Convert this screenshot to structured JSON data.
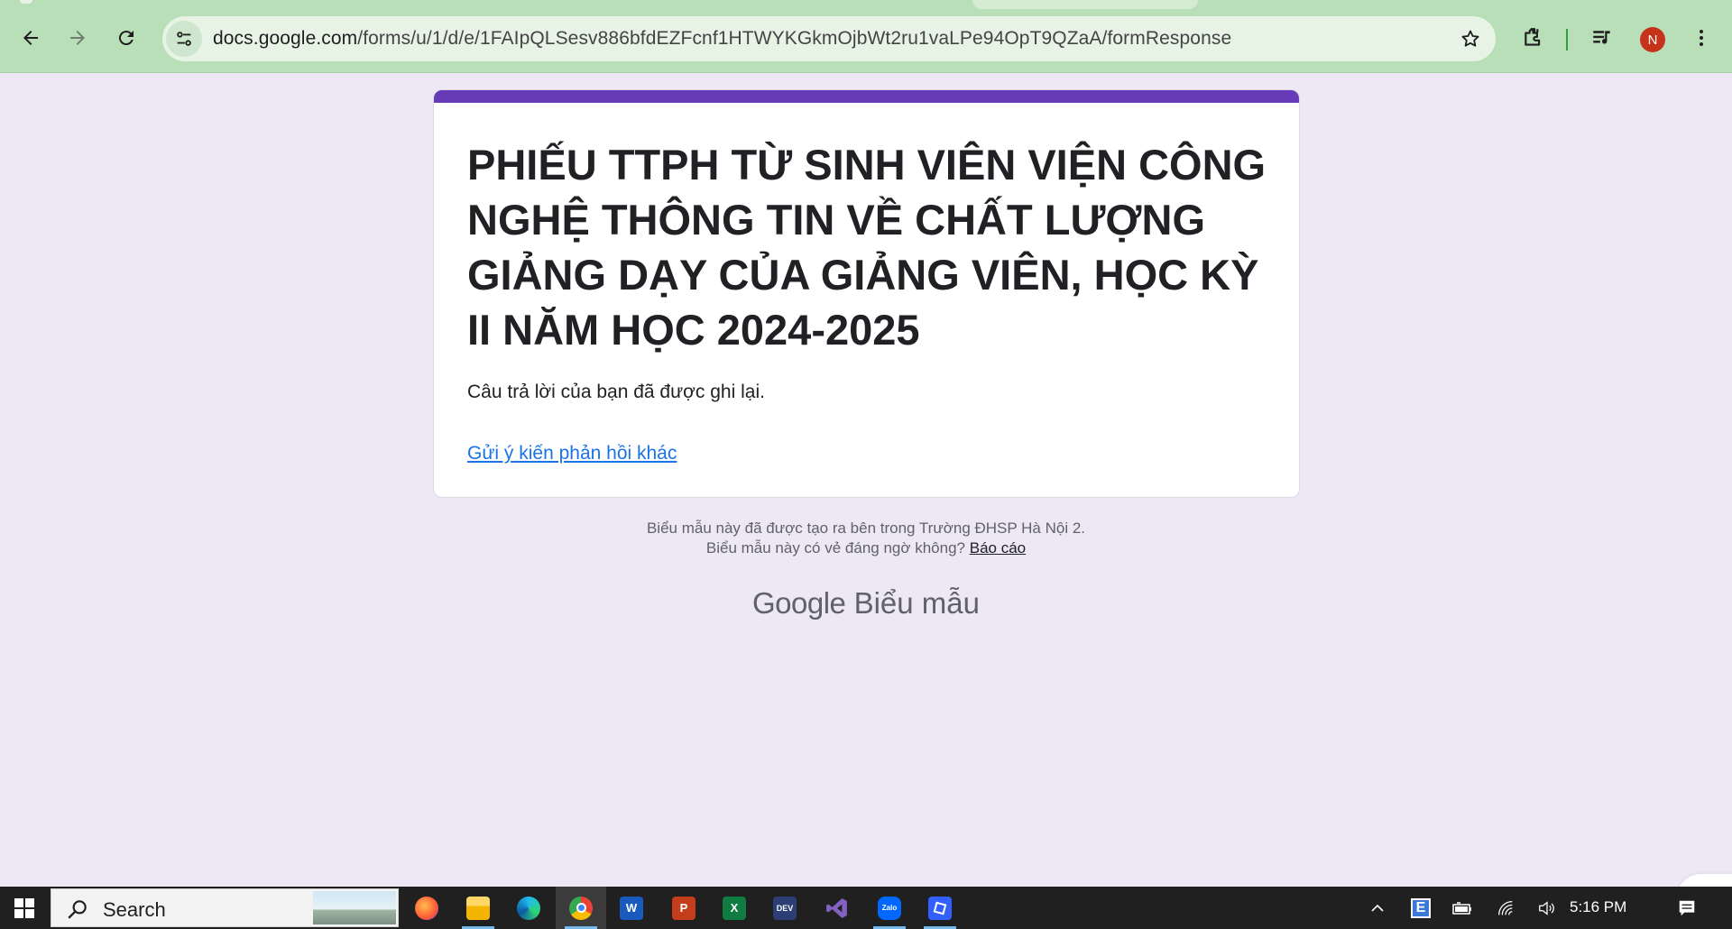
{
  "browser": {
    "url_host": "docs.google.com",
    "url_path": "/forms/u/1/d/e/1FAIpQLSesv886bfdEZFcnf1HTWYKGkmOjbWt2ru1vaLPe94OpT9QZaA/formResponse",
    "profile_initial": "N",
    "icons": [
      "back-icon",
      "forward-icon",
      "reload-icon",
      "site-info-icon",
      "bookmark-star-icon",
      "extensions-icon",
      "media-control-icon",
      "menu-kebab-icon"
    ]
  },
  "form": {
    "title": "PHIẾU TTPH TỪ SINH VIÊN VIỆN CÔNG NGHỆ THÔNG TIN VỀ CHẤT LƯỢNG GIẢNG DẠY CỦA GIẢNG VIÊN, HỌC KỲ II NĂM HỌC 2024-2025",
    "confirmation": "Câu trả lời của bạn đã được ghi lại.",
    "submit_another": "Gửi ý kiến phản hồi khác",
    "accent_color": "#673ab7"
  },
  "footer": {
    "line1": "Biểu mẫu này đã được tạo ra bên trong Trường ĐHSP Hà Nội 2.",
    "line2": "Biểu mẫu này có vẻ đáng ngờ không?",
    "report": "Báo cáo",
    "brand_google": "Google",
    "brand_product": "Biểu mẫu"
  },
  "taskbar": {
    "search_label": "Search",
    "clock": "5:16 PM",
    "apps": [
      "firefox-icon",
      "file-explorer-icon",
      "edge-icon",
      "chrome-icon",
      "word-icon",
      "powerpoint-icon",
      "excel-icon",
      "devcpp-icon",
      "visual-studio-icon",
      "zalo-icon",
      "roblox-studio-icon"
    ],
    "tray": [
      "show-hidden-icons",
      "keyboard-language-icon",
      "battery-icon",
      "wifi-icon",
      "volume-icon",
      "notifications-icon"
    ]
  }
}
